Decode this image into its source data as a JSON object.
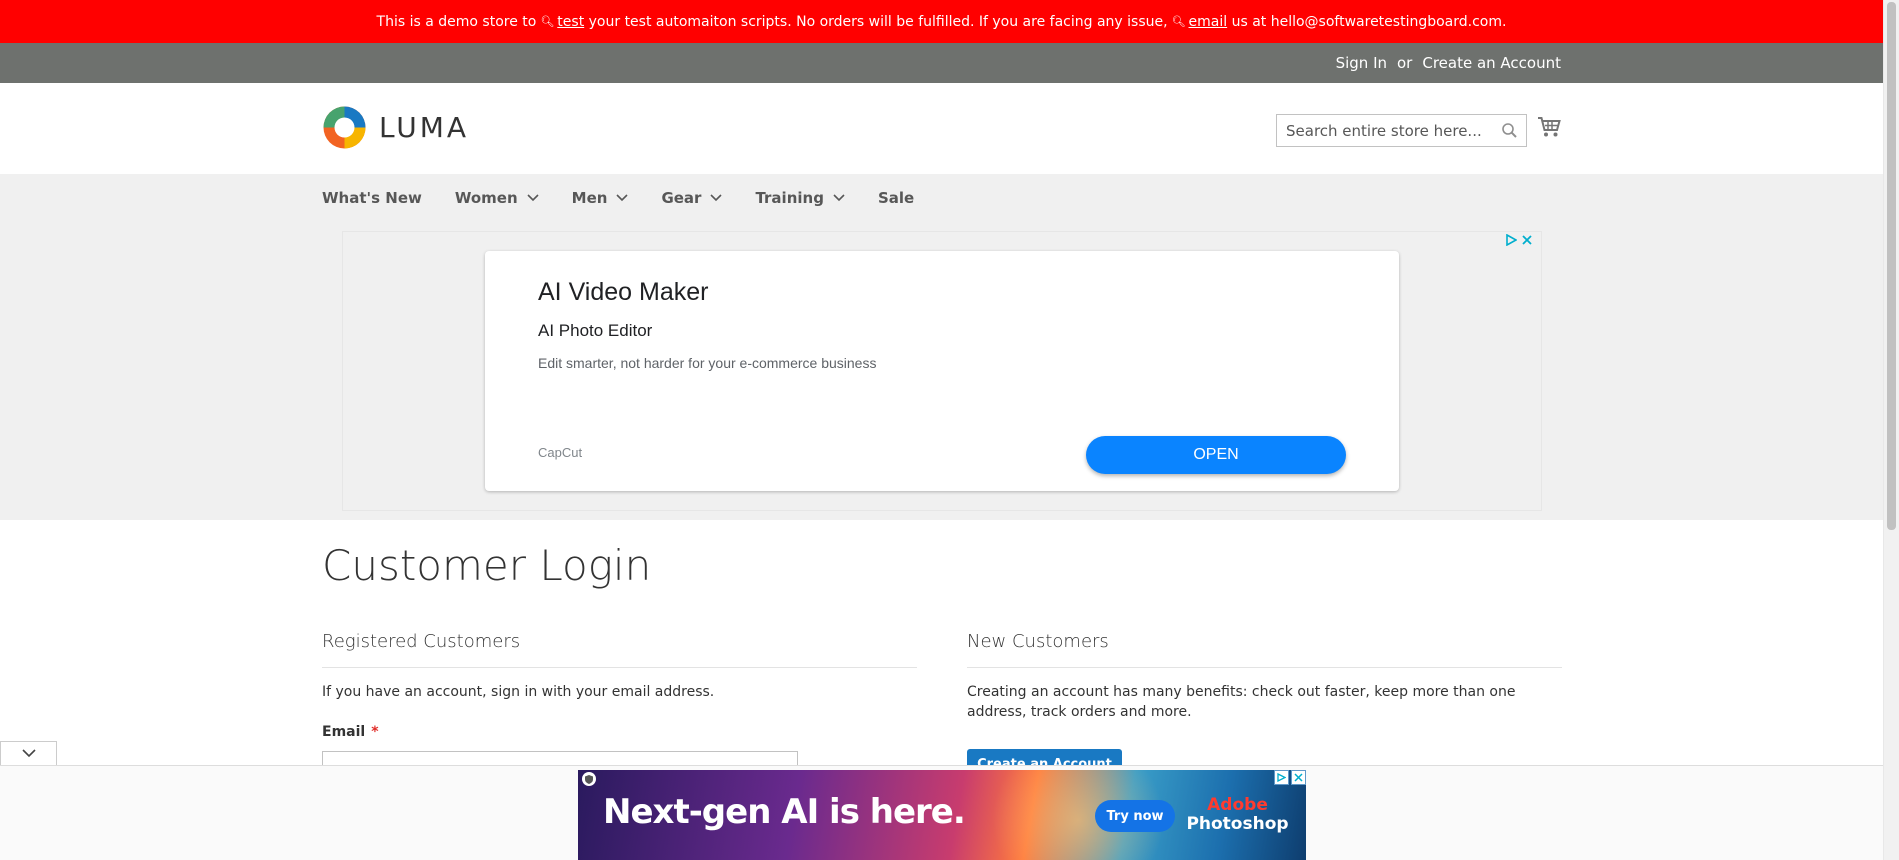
{
  "demo_banner": {
    "part1": "This is a demo store to",
    "link1": "test",
    "part2": "your test automaiton scripts. No orders will be fulfilled. If you are facing any issue,",
    "link2": "email",
    "part3": "us at hello@softwaretestingboard.com."
  },
  "panel": {
    "sign_in": "Sign In",
    "or": "or",
    "create_account": "Create an Account"
  },
  "header": {
    "logo_text": "LUMA",
    "search_placeholder": "Search entire store here..."
  },
  "nav": {
    "items": [
      {
        "label": "What's New",
        "has_dropdown": false
      },
      {
        "label": "Women",
        "has_dropdown": true
      },
      {
        "label": "Men",
        "has_dropdown": true
      },
      {
        "label": "Gear",
        "has_dropdown": true
      },
      {
        "label": "Training",
        "has_dropdown": true
      },
      {
        "label": "Sale",
        "has_dropdown": false
      }
    ]
  },
  "ad": {
    "title": "AI Video Maker",
    "subtitle": "AI Photo Editor",
    "description": "Edit smarter, not harder for your e-commerce business",
    "brand": "CapCut",
    "cta": "OPEN"
  },
  "main": {
    "page_title": "Customer Login",
    "registered": {
      "title": "Registered Customers",
      "intro": "If you have an account, sign in with your email address.",
      "email_label": "Email",
      "required_mark": "*"
    },
    "new_customers": {
      "title": "New Customers",
      "text": "Creating an account has many benefits: check out faster, keep more than one address, track orders and more.",
      "button": "Create an Account"
    }
  },
  "bottom_ad": {
    "headline": "Next-gen AI is here.",
    "cta": "Try now",
    "brand_top": "Adobe",
    "brand_bottom": "Photoshop"
  },
  "colors": {
    "banner": "#ff0000",
    "panel": "#6e716e",
    "primary_button": "#1979c3",
    "ad_button": "#0a84ff",
    "required": "#e02b27"
  }
}
